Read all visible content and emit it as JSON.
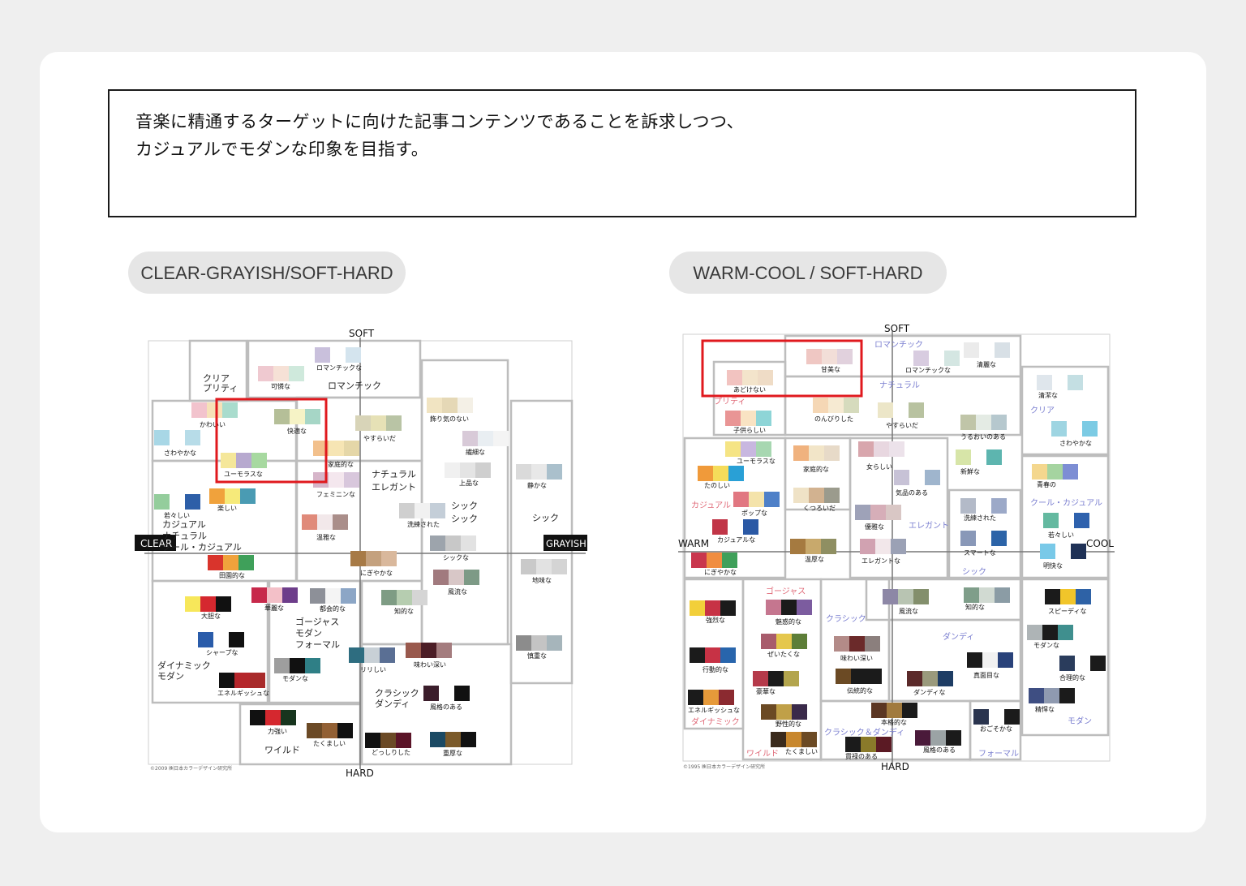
{
  "description": {
    "line1": "音楽に精通するターゲットに向けた記事コンテンツであることを訴求しつつ、",
    "line2": "カジュアルでモダンな印象を目指す。"
  },
  "chart1": {
    "label": "CLEAR-GRAYISH/SOFT-HARD",
    "axis_top": "SOFT",
    "axis_bottom": "HARD",
    "axis_left": "CLEAR",
    "axis_right": "GRAYISH",
    "copyright": "©2009 ㈱日本カラーデザイン研究所",
    "groups": [
      "クリア",
      "プリティ",
      "ロマンチック",
      "ナチュラル",
      "エレガント",
      "シック",
      "カジュアル",
      "ナチュラル",
      "クール・カジュアル",
      "ゴージャス",
      "モダン",
      "フォーマル",
      "ダイナミック",
      "モダン",
      "クラシック",
      "ダンディ",
      "ワイルド"
    ],
    "words": [
      "ロマンチックな",
      "可憐な",
      "かわいい",
      "快適な",
      "やすらいだ",
      "飾り気のない",
      "繊細な",
      "さわやかな",
      "ユーモラスな",
      "家庭的な",
      "フェミニンな",
      "上品な",
      "静かな",
      "若々しい",
      "楽しい",
      "洗練された",
      "温雅な",
      "シックな",
      "田園的な",
      "にぎやかな",
      "地味な",
      "風流な",
      "華麗な",
      "都会的な",
      "知的な",
      "大胆な",
      "シャープな",
      "モダンな",
      "リリしい",
      "味わい深い",
      "慎重な",
      "エネルギッシュな",
      "風格のある",
      "力強い",
      "たくましい",
      "どっしりした",
      "重厚な"
    ]
  },
  "chart2": {
    "label": "WARM-COOL / SOFT-HARD",
    "axis_top": "SOFT",
    "axis_bottom": "HARD",
    "axis_left": "WARM",
    "axis_right": "COOL",
    "copyright": "©1995 ㈱日本カラーデザイン研究所",
    "groups": [
      "ロマンチック",
      "プリティ",
      "ナチュラル",
      "クリア",
      "カジュアル",
      "エレガント",
      "クール・カジュアル",
      "シック",
      "ゴージャス",
      "クラシック",
      "ダンディ",
      "ダイナミック",
      "モダン",
      "ワイルド",
      "クラシック＆ダンディ",
      "フォーマル"
    ],
    "words": [
      "甘美な",
      "ロマンチックな",
      "清麗な",
      "あどけない",
      "清潔な",
      "のんびりした",
      "やすらいだ",
      "子供らしい",
      "うるおいのある",
      "さわやかな",
      "ユーモラスな",
      "家庭的な",
      "女らしい",
      "新鮮な",
      "たのしい",
      "気品のある",
      "青春の",
      "ポップな",
      "くつろいだ",
      "洗練された",
      "優雅な",
      "若々しい",
      "カジュアルな",
      "温厚な",
      "エレガントな",
      "スマートな",
      "明快な",
      "にぎやかな",
      "魅惑的な",
      "風流な",
      "知的な",
      "スピーディな",
      "強烈な",
      "ぜいたくな",
      "味わい深い",
      "モダンな",
      "行動的な",
      "豪華な",
      "伝統的な",
      "ダンディな",
      "真面目な",
      "合理的な",
      "エネルギッシュな",
      "野性的な",
      "本格的な",
      "おごそかな",
      "精悍な",
      "たくましい",
      "貫禄のある",
      "風格のある"
    ]
  },
  "colors": {
    "card": "#ffffff",
    "page": "#efefef",
    "pill": "#e6e6e6",
    "highlight": "#e0191e"
  }
}
